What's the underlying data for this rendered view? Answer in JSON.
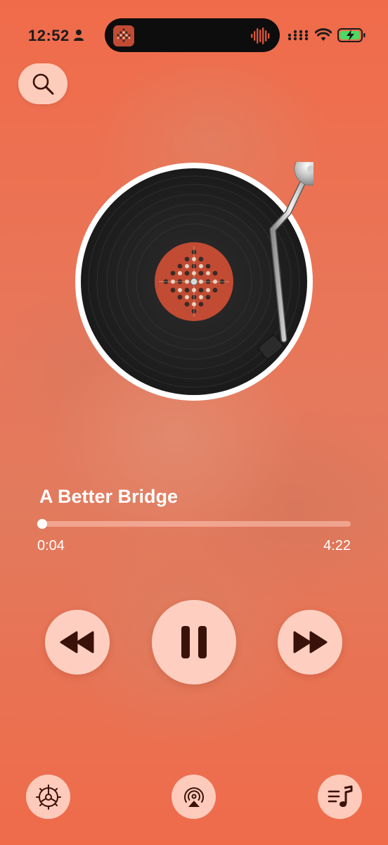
{
  "status_bar": {
    "time": "12:52",
    "icons": [
      "person-icon",
      "signal-icon",
      "wifi-icon",
      "battery-charging-icon"
    ]
  },
  "dynamic_island": {
    "icons": [
      "album-art-thumbnail",
      "waveform-icon"
    ],
    "waveform_color": "#d9533a"
  },
  "search": {
    "icon": "search-icon"
  },
  "player": {
    "track_title": "A Better Bridge",
    "elapsed": "0:04",
    "duration": "4:22",
    "progress_fraction": 0.016
  },
  "controls": {
    "rewind_icon": "rewind-icon",
    "pause_icon": "pause-icon",
    "forward_icon": "fast-forward-icon"
  },
  "bottom_bar": {
    "icons": [
      "settings-gear-icon",
      "airplay-icon",
      "queue-music-icon"
    ]
  },
  "colors": {
    "background": "#ee6c4c",
    "button_fill": "#ffd4c6",
    "icon_dark": "#3a120a",
    "label_orange": "#c8452c",
    "battery_green": "#4cd964"
  }
}
